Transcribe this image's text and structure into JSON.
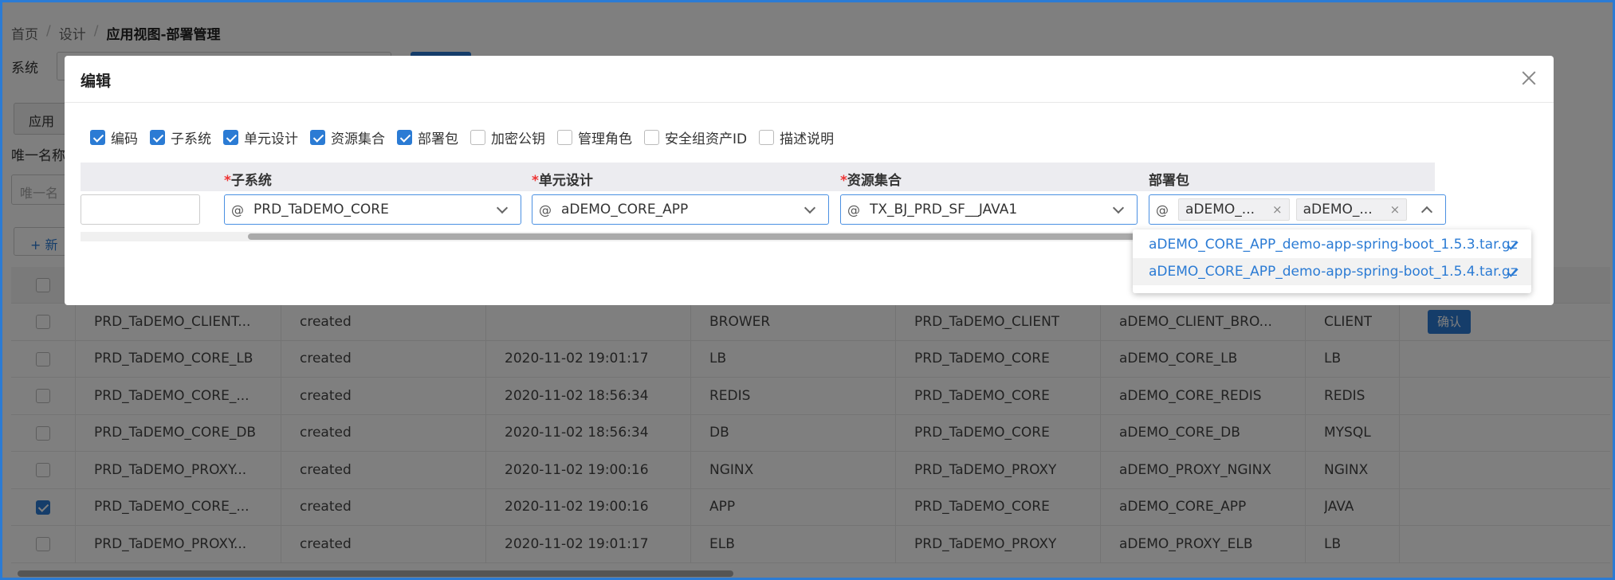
{
  "breadcrumb": {
    "home": "首页",
    "design": "设计",
    "current": "应用视图-部署管理",
    "separator": "/"
  },
  "filters": {
    "system_label": "系统",
    "unique_name_label": "唯一名称",
    "unique_name_placeholder": "唯一名"
  },
  "tabs": {
    "app": "应用"
  },
  "toolbar": {
    "add_label": "+ 新"
  },
  "table": {
    "rows": [
      {
        "name": "PRD_TaDEMO_CLIENT...",
        "status": "created",
        "time": "",
        "type": "BROWER",
        "subsystem": "PRD_TaDEMO_CLIENT",
        "unit": "aDEMO_CLIENT_BRO...",
        "kind": "CLIENT",
        "checked": false,
        "action": "确认"
      },
      {
        "name": "PRD_TaDEMO_CORE_LB",
        "status": "created",
        "time": "2020-11-02 19:01:17",
        "type": "LB",
        "subsystem": "PRD_TaDEMO_CORE",
        "unit": "aDEMO_CORE_LB",
        "kind": "LB",
        "checked": false,
        "action": ""
      },
      {
        "name": "PRD_TaDEMO_CORE_...",
        "status": "created",
        "time": "2020-11-02 18:56:34",
        "type": "REDIS",
        "subsystem": "PRD_TaDEMO_CORE",
        "unit": "aDEMO_CORE_REDIS",
        "kind": "REDIS",
        "checked": false,
        "action": ""
      },
      {
        "name": "PRD_TaDEMO_CORE_DB",
        "status": "created",
        "time": "2020-11-02 18:56:34",
        "type": "DB",
        "subsystem": "PRD_TaDEMO_CORE",
        "unit": "aDEMO_CORE_DB",
        "kind": "MYSQL",
        "checked": false,
        "action": ""
      },
      {
        "name": "PRD_TaDEMO_PROXY...",
        "status": "created",
        "time": "2020-11-02 19:00:16",
        "type": "NGINX",
        "subsystem": "PRD_TaDEMO_PROXY",
        "unit": "aDEMO_PROXY_NGINX",
        "kind": "NGINX",
        "checked": false,
        "action": ""
      },
      {
        "name": "PRD_TaDEMO_CORE_...",
        "status": "created",
        "time": "2020-11-02 19:00:16",
        "type": "APP",
        "subsystem": "PRD_TaDEMO_CORE",
        "unit": "aDEMO_CORE_APP",
        "kind": "JAVA",
        "checked": true,
        "action": ""
      },
      {
        "name": "PRD_TaDEMO_PROXY...",
        "status": "created",
        "time": "2020-11-02 19:01:17",
        "type": "ELB",
        "subsystem": "PRD_TaDEMO_PROXY",
        "unit": "aDEMO_PROXY_ELB",
        "kind": "LB",
        "checked": false,
        "action": ""
      }
    ]
  },
  "modal": {
    "title": "编辑",
    "column_toggles": [
      {
        "label": "编码",
        "checked": true
      },
      {
        "label": "子系统",
        "checked": true
      },
      {
        "label": "单元设计",
        "checked": true
      },
      {
        "label": "资源集合",
        "checked": true
      },
      {
        "label": "部署包",
        "checked": true
      },
      {
        "label": "加密公钥",
        "checked": false
      },
      {
        "label": "管理角色",
        "checked": false
      },
      {
        "label": "安全组资产ID",
        "checked": false
      },
      {
        "label": "描述说明",
        "checked": false
      }
    ],
    "headers": {
      "required_mark": "*",
      "subsystem": "子系统",
      "unit_design": "单元设计",
      "resource_set": "资源集合",
      "package": "部署包"
    },
    "fields": {
      "prefix": "@",
      "subsystem": "PRD_TaDEMO_CORE",
      "unit_design": "aDEMO_CORE_APP",
      "resource_set": "TX_BJ_PRD_SF__JAVA1",
      "package_tags": [
        "aDEMO_...",
        "aDEMO_..."
      ],
      "tag_remove": "×"
    },
    "dropdown_options": [
      {
        "label": "aDEMO_CORE_APP_demo-app-spring-boot_1.5.3.tar.gz",
        "selected": false
      },
      {
        "label": "aDEMO_CORE_APP_demo-app-spring-boot_1.5.4.tar.gz",
        "selected": true
      }
    ]
  },
  "colors": {
    "accent": "#2b7bd4",
    "frame": "#2b7bd4",
    "required": "#e33333"
  }
}
